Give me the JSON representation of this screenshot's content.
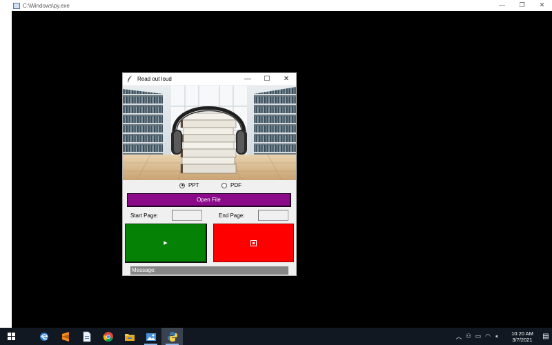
{
  "console": {
    "title": "C:\\Windows\\py.exe",
    "controls": [
      "minimize",
      "restore",
      "close"
    ]
  },
  "app": {
    "title": "Read out loud",
    "icons": {
      "window": "feather-icon"
    },
    "radio_options": [
      {
        "label": "PPT",
        "selected": true
      },
      {
        "label": "PDF",
        "selected": false
      }
    ],
    "open_file_label": "Open File",
    "start_page_label": "Start Page:",
    "start_page_value": "",
    "end_page_label": "End Page:",
    "end_page_value": "",
    "play_symbol": "▶",
    "message_label": "Message:",
    "colors": {
      "open_button": "#8a0a8a",
      "play_button": "#058205",
      "stop_button": "#ff0000",
      "message_bar": "#858585"
    }
  },
  "taskbar": {
    "apps": [
      "start-icon",
      "edge-legacy-icon",
      "sublime-icon",
      "file-icon",
      "chrome-icon",
      "file-explorer-icon",
      "photos-icon",
      "python-icon"
    ],
    "clock_time": "10:20 AM",
    "clock_date": "3/7/2021"
  }
}
